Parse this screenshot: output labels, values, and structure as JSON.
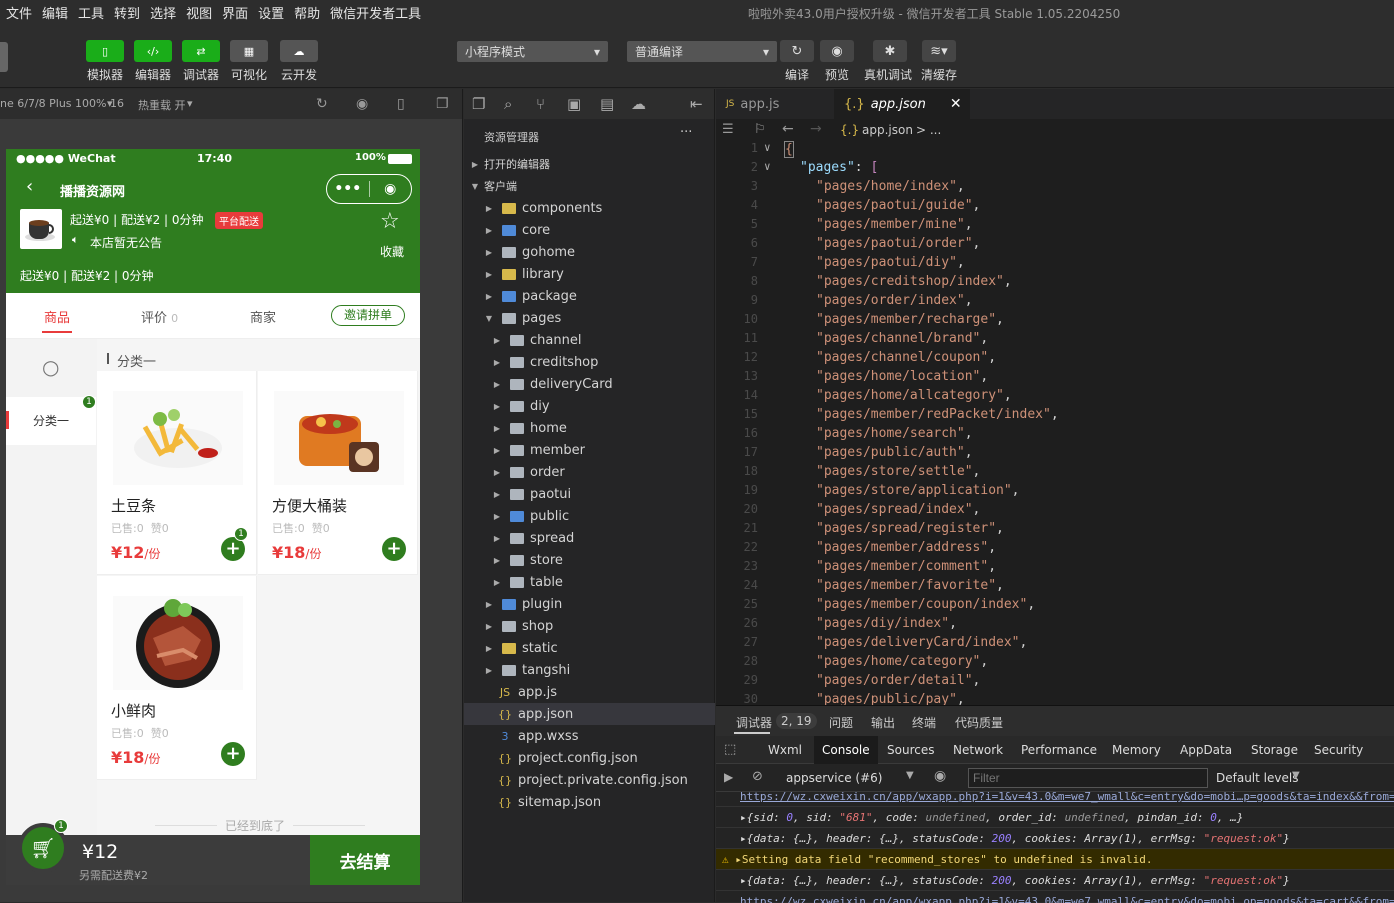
{
  "menus": [
    "文件",
    "编辑",
    "工具",
    "转到",
    "选择",
    "视图",
    "界面",
    "设置",
    "帮助",
    "微信开发者工具"
  ],
  "window_title": "啦啦外卖43.0用户授权升级 - 微信开发者工具 Stable 1.05.2204250",
  "toolbar": {
    "simulator": "模拟器",
    "editor": "编辑器",
    "debugger": "调试器",
    "visual": "可视化",
    "cloud": "云开发",
    "mode_select": "小程序模式",
    "compile_select": "普通编译",
    "compile": "编译",
    "preview": "预览",
    "real_debug": "真机调试",
    "clear_cache": "清缓存"
  },
  "simbar": {
    "device": "ne 6/7/8 Plus 100% 16",
    "hotreload": "热重载 开"
  },
  "phone": {
    "carrier": "●●●●● WeChat",
    "time": "17:40",
    "battery": "100%",
    "title": "播播资源网",
    "delivery": "起送¥0 | 配送¥2 | 0分钟",
    "platform_badge": "平台配送",
    "notice": "本店暂无公告",
    "favorite": "收藏",
    "delivery2": "起送¥0 | 配送¥2 | 0分钟",
    "tabs": {
      "goods": "商品",
      "reviews": "评价",
      "reviews_count": "0",
      "merchant": "商家",
      "group": "邀请拼单"
    },
    "category_header": "分类一",
    "left_category": "分类一",
    "left_badge": "1",
    "products": [
      {
        "name": "土豆条",
        "sold": "已售:0",
        "likes": "赞0",
        "price": "12",
        "unit": "/份",
        "badge": "1"
      },
      {
        "name": "方便大桶装",
        "sold": "已售:0",
        "likes": "赞0",
        "price": "18",
        "unit": "/份"
      },
      {
        "name": "小鲜肉",
        "sold": "已售:0",
        "likes": "赞0",
        "price": "18",
        "unit": "/份"
      }
    ],
    "end_text": "已经到底了",
    "cart_badge": "1",
    "cart_total": "¥12",
    "cart_fee": "另需配送费¥2",
    "checkout": "去结算"
  },
  "explorer": {
    "title": "资源管理器",
    "open_editors": "打开的编辑器",
    "client": "客户端",
    "folders": [
      {
        "name": "components",
        "color": "yel",
        "depth": 1
      },
      {
        "name": "core",
        "color": "blue",
        "depth": 1
      },
      {
        "name": "gohome",
        "color": "grey",
        "depth": 1
      },
      {
        "name": "library",
        "color": "yel",
        "depth": 1
      },
      {
        "name": "package",
        "color": "blue",
        "depth": 1
      },
      {
        "name": "pages",
        "color": "grey",
        "depth": 1,
        "open": true
      },
      {
        "name": "channel",
        "color": "grey",
        "depth": 2
      },
      {
        "name": "creditshop",
        "color": "grey",
        "depth": 2
      },
      {
        "name": "deliveryCard",
        "color": "grey",
        "depth": 2
      },
      {
        "name": "diy",
        "color": "grey",
        "depth": 2
      },
      {
        "name": "home",
        "color": "grey",
        "depth": 2
      },
      {
        "name": "member",
        "color": "grey",
        "depth": 2
      },
      {
        "name": "order",
        "color": "grey",
        "depth": 2
      },
      {
        "name": "paotui",
        "color": "grey",
        "depth": 2
      },
      {
        "name": "public",
        "color": "blue",
        "depth": 2
      },
      {
        "name": "spread",
        "color": "grey",
        "depth": 2
      },
      {
        "name": "store",
        "color": "grey",
        "depth": 2
      },
      {
        "name": "table",
        "color": "grey",
        "depth": 2
      },
      {
        "name": "plugin",
        "color": "blue",
        "depth": 1
      },
      {
        "name": "shop",
        "color": "grey",
        "depth": 1
      },
      {
        "name": "static",
        "color": "yel",
        "depth": 1
      },
      {
        "name": "tangshi",
        "color": "grey",
        "depth": 1
      }
    ],
    "files": [
      {
        "name": "app.js",
        "icon": "JS",
        "color": "#d7b94b"
      },
      {
        "name": "app.json",
        "icon": "{}",
        "color": "#d7b94b",
        "active": true
      },
      {
        "name": "app.wxss",
        "icon": "3",
        "color": "#4f8ad8"
      },
      {
        "name": "project.config.json",
        "icon": "{}",
        "color": "#d7b94b"
      },
      {
        "name": "project.private.config.json",
        "icon": "{}",
        "color": "#d7b94b"
      },
      {
        "name": "sitemap.json",
        "icon": "{}",
        "color": "#d7b94b"
      }
    ]
  },
  "editor": {
    "tab1": "app.js",
    "tab2": "app.json",
    "breadcrumb_file": "app.json",
    "breadcrumb_rest": "> ...",
    "pages_key": "\"pages\"",
    "pages": [
      "pages/home/index",
      "pages/paotui/guide",
      "pages/member/mine",
      "pages/paotui/order",
      "pages/paotui/diy",
      "pages/creditshop/index",
      "pages/order/index",
      "pages/member/recharge",
      "pages/channel/brand",
      "pages/channel/coupon",
      "pages/home/location",
      "pages/home/allcategory",
      "pages/member/redPacket/index",
      "pages/home/search",
      "pages/public/auth",
      "pages/store/settle",
      "pages/store/application",
      "pages/spread/index",
      "pages/spread/register",
      "pages/member/address",
      "pages/member/comment",
      "pages/member/favorite",
      "pages/member/coupon/index",
      "pages/diy/index",
      "pages/deliveryCard/index",
      "pages/home/category",
      "pages/order/detail",
      "pages/public/pay"
    ]
  },
  "devtools": {
    "debugger": "调试器",
    "debugger_badge": "2, 19",
    "problems": "问题",
    "output": "输出",
    "terminal": "终端",
    "quality": "代码质量",
    "tabs": [
      "Wxml",
      "Console",
      "Sources",
      "Network",
      "Performance",
      "Memory",
      "AppData",
      "Storage",
      "Security"
    ],
    "context": "appservice (#6)",
    "filter_placeholder": "Filter",
    "levels": "Default levels",
    "log1": "https://wz.cxweixin.cn/app/wxapp.php?i=1&v=43.0&m=we7_wmall&c=entry&do=mobi…p=goods&ta=index&&from=w",
    "log2_sid": "\"681\"",
    "log3_status": "200",
    "log3_msg": "\"request:ok\"",
    "warning": "Setting data field \"recommend_stores\" to undefined is invalid.",
    "log5_status": "200",
    "log5_msg": "\"request:ok\"",
    "log6": "https://wz.cxweixin.cn/app/wxapp.php?i=1&v=43.0&m=we7_wmall&c=entry&do=mobi…op=goods&ta=cart&&from=w"
  }
}
